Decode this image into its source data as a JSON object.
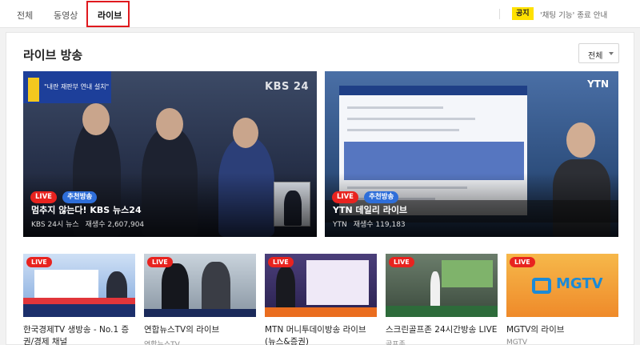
{
  "tabs": [
    {
      "label": "전체"
    },
    {
      "label": "동영상"
    },
    {
      "label": "라이브"
    }
  ],
  "notice": {
    "badge": "공지",
    "text": "'채팅 기능' 종료 안내"
  },
  "section": {
    "title": "라이브 방송",
    "filter_label": "전체"
  },
  "featured": [
    {
      "live": "LIVE",
      "badge": "추천방송",
      "title": "멈추지 않는다! KBS 뉴스24",
      "channel": "KBS 24시 뉴스",
      "views": "재생수 2,607,904",
      "overlay_logo": "KBS 24",
      "overlay_banner": "\"내란 재판부 연내 설치\""
    },
    {
      "live": "LIVE",
      "badge": "추천방송",
      "title": "YTN 데일리 라이브",
      "channel": "YTN",
      "views": "재생수 119,183",
      "overlay_logo": "YTN"
    }
  ],
  "list": [
    {
      "live": "LIVE",
      "title": "한국경제TV 생방송 - No.1 증권/경제 채널",
      "sub": ""
    },
    {
      "live": "LIVE",
      "title": "연합뉴스TV의 라이브",
      "sub": "연합뉴스TV"
    },
    {
      "live": "LIVE",
      "title": "MTN 머니투데이방송 라이브 (뉴스&증권)",
      "sub": ""
    },
    {
      "live": "LIVE",
      "title": "스크린골프존 24시간방송 LIVE",
      "sub": "골프존"
    },
    {
      "live": "LIVE",
      "title": "MGTV의 라이브",
      "sub": "MGTV",
      "logo": "MGTV"
    }
  ],
  "colors": {
    "live": "#e8231f",
    "recommend": "#2e6ed9",
    "notice": "#ffe100",
    "tab_highlight": "#e0191e"
  }
}
